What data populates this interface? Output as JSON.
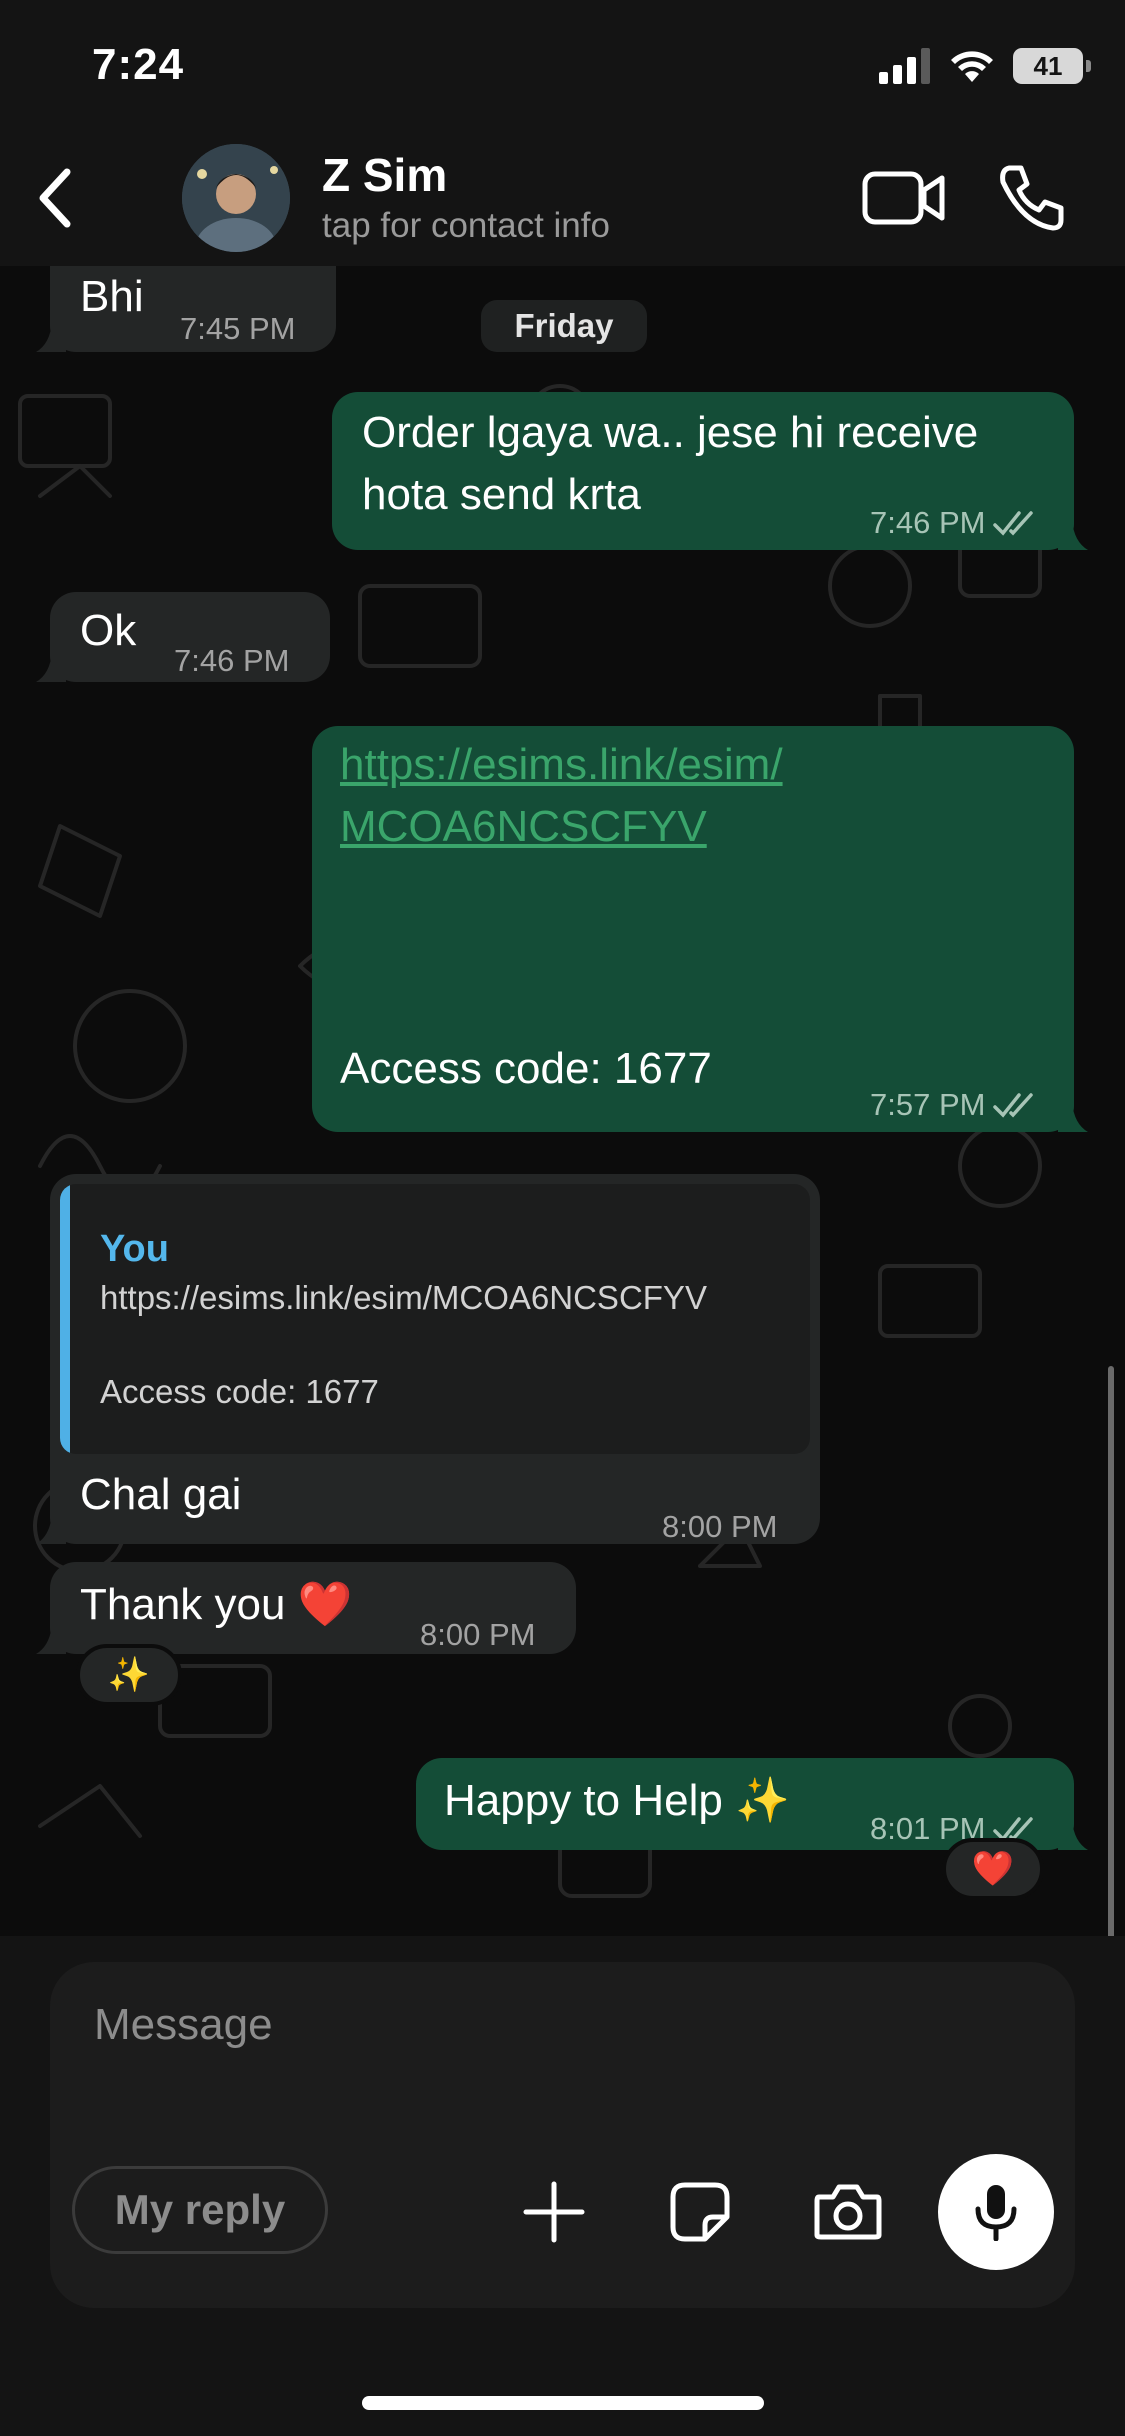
{
  "status_bar": {
    "time": "7:24",
    "battery": "41"
  },
  "header": {
    "contact_name": "Z Sim",
    "contact_subtitle": "tap for contact info"
  },
  "chat": {
    "date_divider": "Friday",
    "messages": [
      {
        "direction": "in",
        "text": "Bhi",
        "time": "7:45 PM"
      },
      {
        "direction": "out",
        "text_lines": [
          "Order lgaya wa.. jese hi receive",
          "hota send krta"
        ],
        "time": "7:46 PM",
        "status": "read"
      },
      {
        "direction": "in",
        "text": "Ok",
        "time": "7:46 PM"
      },
      {
        "direction": "out",
        "link_lines": [
          "https://esims.link/esim/",
          "MCOA6NCSCFYV"
        ],
        "text": "Access code: 1677",
        "time": "7:57 PM",
        "status": "read"
      },
      {
        "direction": "in",
        "quote": {
          "author": "You",
          "text": "https://esims.link/esim/MCOA6NCSCFYV\n\nAccess code: 1677"
        },
        "text": "Chal gai",
        "time": "8:00 PM"
      },
      {
        "direction": "in",
        "text": "Thank you ❤️",
        "time": "8:00 PM",
        "reaction": "✨"
      },
      {
        "direction": "out",
        "text": "Happy to Help ✨",
        "time": "8:01 PM",
        "status": "read",
        "reaction": "❤️"
      }
    ]
  },
  "composer": {
    "placeholder": "Message",
    "my_reply_label": "My reply"
  },
  "colors": {
    "outgoing_bubble": "#144d37",
    "incoming_bubble": "#242626",
    "quote_accent": "#4fb0e6",
    "link": "#3aa56b"
  },
  "icons": [
    "back-chevron-icon",
    "video-call-icon",
    "phone-icon",
    "read-receipt-icon",
    "plus-icon",
    "sticker-icon",
    "camera-icon",
    "microphone-icon"
  ]
}
